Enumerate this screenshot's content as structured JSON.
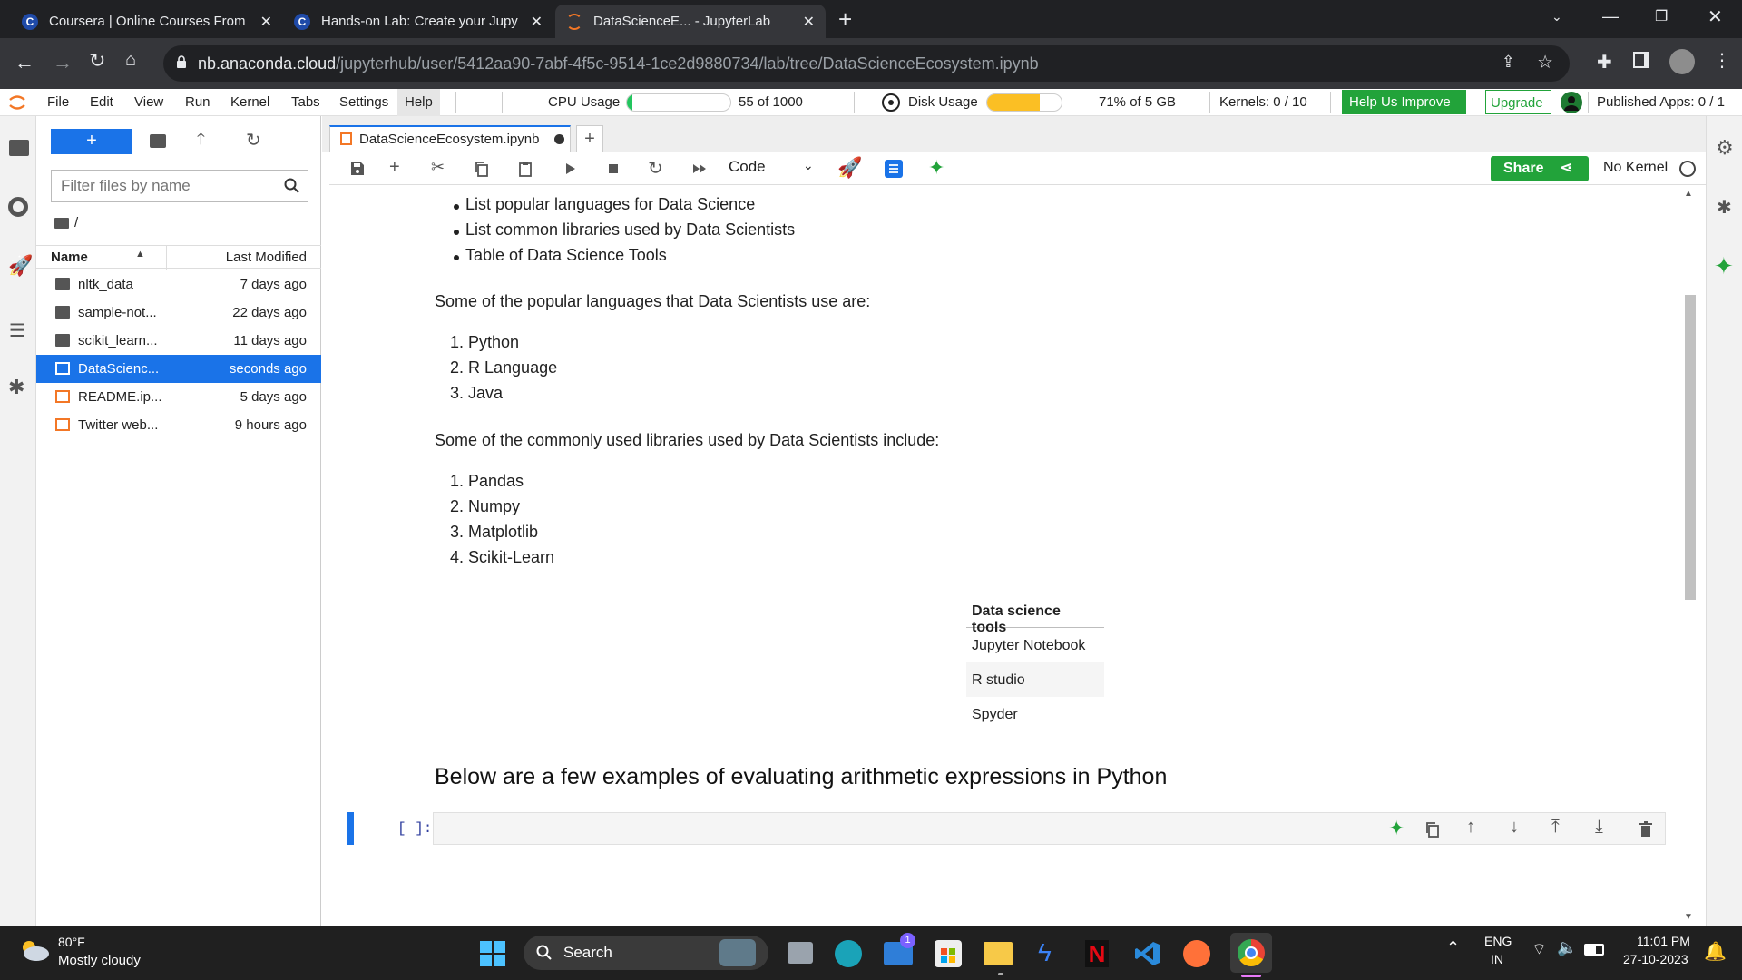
{
  "browser": {
    "tabs": [
      {
        "title": "Coursera | Online Courses From",
        "icon": "coursera-icon"
      },
      {
        "title": "Hands-on Lab: Create your Jupy",
        "icon": "coursera-icon"
      },
      {
        "title": "DataScienceE... - JupyterLab",
        "icon": "jupyter-icon"
      }
    ],
    "url_host": "nb.anaconda.cloud",
    "url_path": "/jupyterhub/user/5412aa90-7abf-4f5c-9514-1ce2d9880734/lab/tree/DataScienceEcosystem.ipynb"
  },
  "menubar": {
    "items": [
      "File",
      "Edit",
      "View",
      "Run",
      "Kernel",
      "Tabs",
      "Settings",
      "Help"
    ],
    "cpu_label": "CPU Usage",
    "cpu_value": "55 of 1000",
    "cpu_fraction": 0.055,
    "disk_label": "Disk Usage",
    "disk_value": "71% of 5 GB",
    "disk_fraction": 0.71,
    "kernels": "Kernels: 0 / 10",
    "help_improve": "Help Us Improve",
    "upgrade": "Upgrade",
    "published_apps": "Published Apps: 0 / 1"
  },
  "filebrowser": {
    "new_label": "+",
    "filter_placeholder": "Filter files by name",
    "path": "/",
    "col_name": "Name",
    "col_modified": "Last Modified",
    "rows": [
      {
        "name": "nltk_data",
        "modified": "7 days ago",
        "type": "folder"
      },
      {
        "name": "sample-not...",
        "modified": "22 days ago",
        "type": "folder"
      },
      {
        "name": "scikit_learn...",
        "modified": "11 days ago",
        "type": "folder"
      },
      {
        "name": "DataScienc...",
        "modified": "seconds ago",
        "type": "notebook",
        "selected": true
      },
      {
        "name": "README.ip...",
        "modified": "5 days ago",
        "type": "notebook"
      },
      {
        "name": "Twitter web...",
        "modified": "9 hours ago",
        "type": "notebook"
      }
    ]
  },
  "notebook": {
    "tab_title": "DataScienceEcosystem.ipynb",
    "cell_type": "Code",
    "share_label": "Share",
    "kernel_status": "No Kernel",
    "objectives": [
      "List popular languages for Data Science",
      "List common libraries used by Data Scientists",
      "Table of Data Science Tools"
    ],
    "languages_intro": "Some of the popular languages that Data Scientists use are:",
    "languages": [
      "1. Python",
      "2. R Language",
      "3. Java"
    ],
    "libraries_intro": "Some of the commonly used libraries used by Data Scientists include:",
    "libraries": [
      "1. Pandas",
      "2. Numpy",
      "3. Matplotlib",
      "4. Scikit-Learn"
    ],
    "table_header": "Data science tools",
    "table_rows": [
      "Jupyter Notebook",
      "R studio",
      "Spyder"
    ],
    "heading": "Below are a few examples of evaluating arithmetic expressions in Python",
    "cell_prompt": "[ ]:"
  },
  "taskbar": {
    "weather_temp": "80°F",
    "weather_desc": "Mostly cloudy",
    "search_label": "Search",
    "mail_badge": "1",
    "lang": "ENG",
    "region": "IN",
    "time": "11:01 PM",
    "date": "27-10-2023"
  },
  "colors": {
    "accent": "#1a73e8",
    "green": "#22c55e",
    "cpu_bar": "#22c55e",
    "disk_bar": "#fbbf24"
  }
}
